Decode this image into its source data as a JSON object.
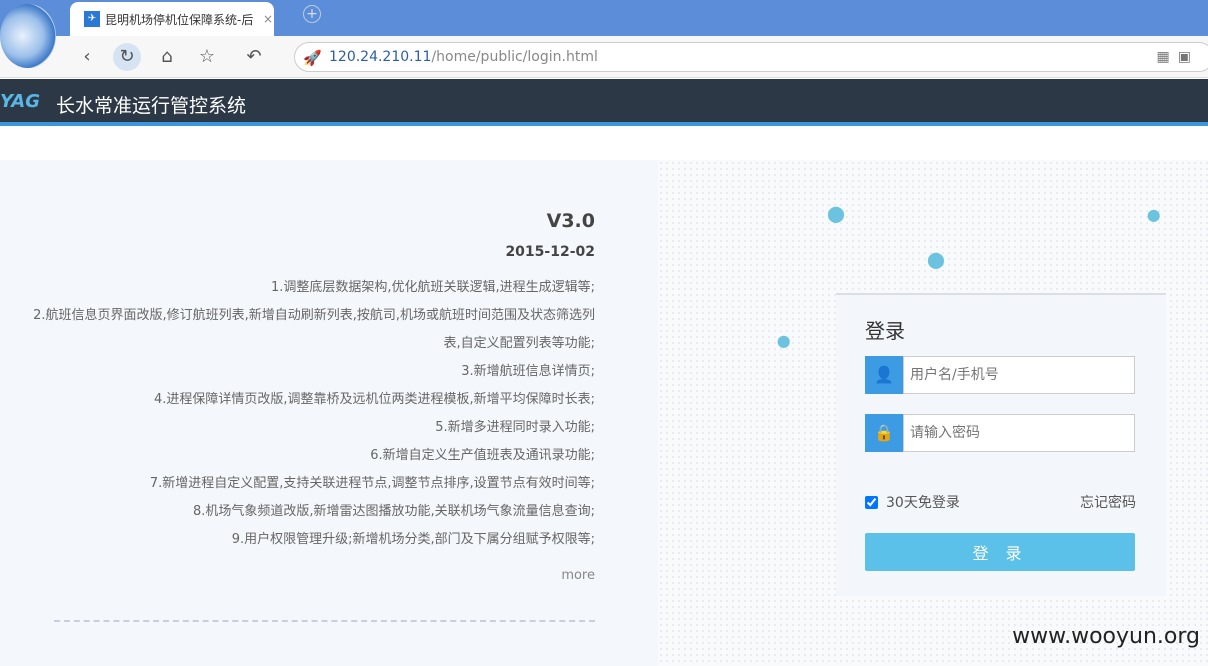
{
  "browser": {
    "tab_title": "昆明机场停机位保障系统-后",
    "tab_close": "×",
    "new_tab": "+",
    "url_host": "120.24.210.11",
    "url_path": "/home/public/login.html"
  },
  "header": {
    "logo": "YAG",
    "title": "长水常准运行管控系统"
  },
  "release": {
    "version": "V3.0",
    "date": "2015-12-02",
    "notes": [
      "1.调整底层数据架构,优化航班关联逻辑,进程生成逻辑等;",
      "2.航班信息页界面改版,修订航班列表,新增自动刷新列表,按航司,机场或航班时间范围及状态筛选列表,自定义配置列表等功能;",
      "3.新增航班信息详情页;",
      "4.进程保障详情页改版,调整靠桥及远机位两类进程模板,新增平均保障时长表;",
      "5.新增多进程同时录入功能;",
      "6.新增自定义生产值班表及通讯录功能;",
      "7.新增进程自定义配置,支持关联进程节点,调整节点排序,设置节点有效时间等;",
      "8.机场气象频道改版,新增雷达图播放功能,关联机场气象流量信息查询;",
      "9.用户权限管理升级;新增机场分类,部门及下属分组赋予权限等;"
    ],
    "more": "more"
  },
  "login": {
    "title": "登录",
    "username_placeholder": "用户名/手机号",
    "password_placeholder": "请输入密码",
    "remember_label": "30天免登录",
    "remember_checked": true,
    "forgot": "忘记密码",
    "submit": "登 录"
  },
  "watermark": "www.wooyun.org",
  "colors": {
    "header": "#2c3846",
    "accent": "#3a96dd",
    "button": "#5bc1e8"
  }
}
